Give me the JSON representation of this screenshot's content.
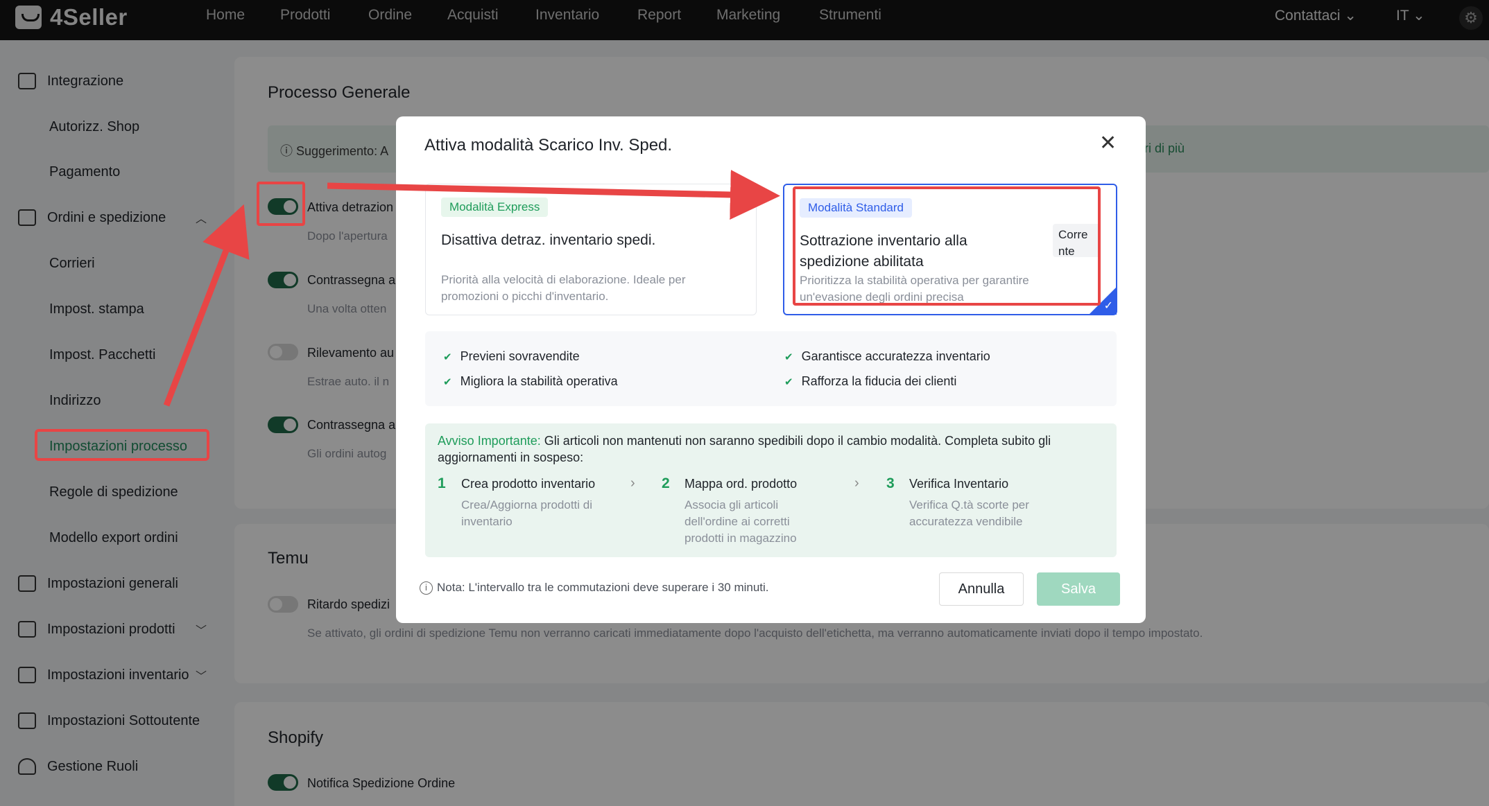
{
  "topbar": {
    "logo": "4Seller",
    "nav": [
      "Home",
      "Prodotti",
      "Ordine",
      "Acquisti",
      "Inventario",
      "Report",
      "Marketing",
      "Strumenti"
    ],
    "contact": "Contattaci ⌄",
    "lang": "IT ⌄",
    "settings_icon": "gear-icon"
  },
  "sidebar": {
    "integrazione": "Integrazione",
    "autorizz": "Autorizz. Shop",
    "pagamento": "Pagamento",
    "ordini": "Ordini e spedizione",
    "corrieri": "Corrieri",
    "stampa": "Impost. stampa",
    "pacchetti": "Impost. Pacchetti",
    "indirizzo": "Indirizzo",
    "processo": "Impostazioni processo",
    "regole": "Regole di spedizione",
    "modello": "Modello export ordini",
    "generali": "Impostazioni generali",
    "prodotti": "Impostazioni prodotti",
    "inventario": "Impostazioni inventario",
    "sottoutente": "Impostazioni Sottoutente",
    "ruoli": "Gestione Ruoli"
  },
  "main": {
    "section1_title": "Processo Generale",
    "tip": "ⓘ Suggerimento: A",
    "tip_more": "ori di più",
    "row1_label": "Attiva detrazion",
    "row1_desc": "Dopo l'apertura",
    "row2_label": "Contrassegna a",
    "row2_desc": "Una volta otten",
    "row3_label": "Rilevamento au",
    "row3_desc": "Estrae auto. il n",
    "row4_label": "Contrassegna a",
    "row4_desc": "Gli ordini autog",
    "section2_title": "Temu",
    "temu_label": "Ritardo spedizi",
    "temu_desc": "Se attivato, gli ordini di spedizione Temu non verranno caricati immediatamente dopo l'acquisto dell'etichetta, ma verranno automaticamente inviati dopo il tempo impostato.",
    "section3_title": "Shopify",
    "shopify_label": "Notifica Spedizione Ordine"
  },
  "modal": {
    "title": "Attiva modalità Scarico Inv. Sped.",
    "express": {
      "tag": "Modalità Express",
      "head": "Disattiva detraz. inventario spedi.",
      "desc": "Priorità alla velocità di elaborazione. Ideale per promozioni o picchi d'inventario."
    },
    "standard": {
      "tag": "Modalità Standard",
      "head_line1": "Sottrazione inventario alla",
      "head_line2": "spedizione abilitata",
      "current_line1": "Corre",
      "current_line2": "nte",
      "desc": "Prioritizza la stabilità operativa per garantire un'evasione degli ordini precisa"
    },
    "benefits": [
      "Previeni sovravendite",
      "Migliora la stabilità operativa",
      "Garantisce accuratezza inventario",
      "Rafforza la fiducia dei clienti"
    ],
    "warning_label": "Avviso Importante:",
    "warning_text": " Gli articoli non mantenuti non saranno spedibili dopo il cambio modalità. Completa subito gli aggiornamenti in sospeso:",
    "steps": [
      {
        "num": "1",
        "title": "Crea prodotto inventario",
        "desc": "Crea/Aggiorna prodotti di inventario"
      },
      {
        "num": "2",
        "title": "Mappa ord. prodotto",
        "desc": "Associa gli articoli dell'ordine ai corretti prodotti in magazzino"
      },
      {
        "num": "3",
        "title": "Verifica Inventario",
        "desc": "Verifica Q.tà scorte per accuratezza vendibile"
      }
    ],
    "note": "Nota: L'intervallo tra le commutazioni deve superare i 30 minuti.",
    "cancel": "Annulla",
    "save": "Salva"
  },
  "colors": {
    "accent_green": "#1e9c5a",
    "toggle_on": "#1f6b4a",
    "selected_blue": "#2f5de8",
    "annotation_red": "#e84545"
  }
}
